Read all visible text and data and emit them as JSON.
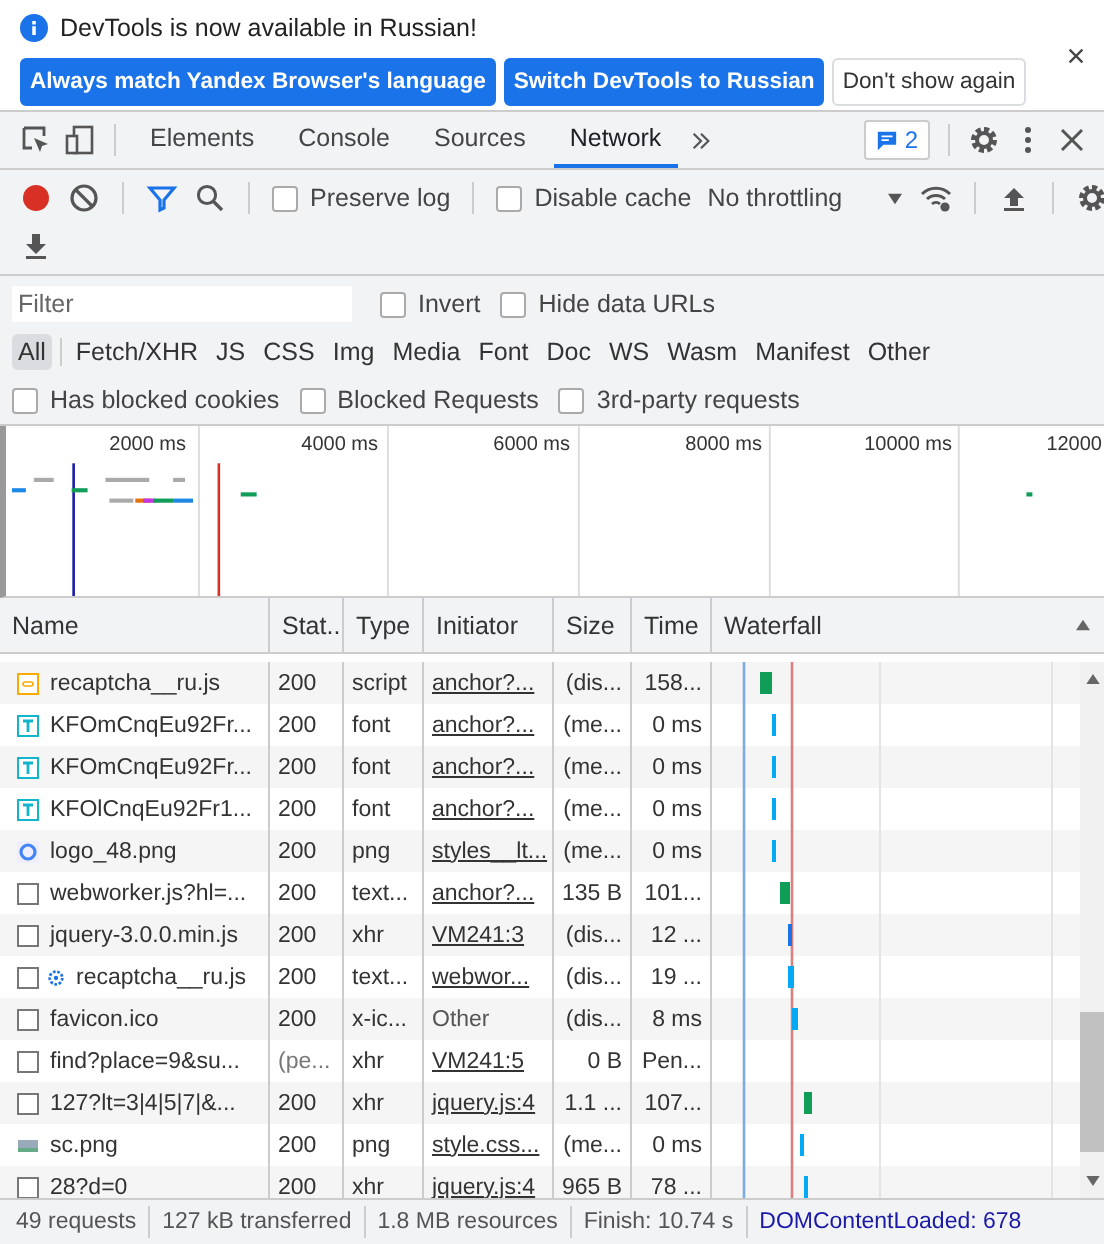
{
  "infobar": {
    "message": "DevTools is now available in Russian!",
    "buttons": [
      {
        "label": "Always match Yandex Browser's language",
        "kind": "primary"
      },
      {
        "label": "Switch DevTools to Russian",
        "kind": "primary"
      },
      {
        "label": "Don't show again",
        "kind": "secondary"
      }
    ]
  },
  "tabs": [
    {
      "label": "Elements",
      "selected": false
    },
    {
      "label": "Console",
      "selected": false
    },
    {
      "label": "Sources",
      "selected": false
    },
    {
      "label": "Network",
      "selected": true
    }
  ],
  "issues_badge": "2",
  "toolbar": {
    "recording": true,
    "filter_active": true,
    "checkboxes": [
      {
        "label": "Preserve log",
        "checked": false
      },
      {
        "label": "Disable cache",
        "checked": false
      }
    ],
    "throttling": "No throttling"
  },
  "filter": {
    "placeholder": "Filter",
    "checkboxes": [
      {
        "label": "Invert",
        "checked": false
      },
      {
        "label": "Hide data URLs",
        "checked": false
      }
    ]
  },
  "type_filters": [
    {
      "label": "All",
      "selected": true
    },
    {
      "label": "Fetch/XHR",
      "selected": false
    },
    {
      "label": "JS",
      "selected": false
    },
    {
      "label": "CSS",
      "selected": false
    },
    {
      "label": "Img",
      "selected": false
    },
    {
      "label": "Media",
      "selected": false
    },
    {
      "label": "Font",
      "selected": false
    },
    {
      "label": "Doc",
      "selected": false
    },
    {
      "label": "WS",
      "selected": false
    },
    {
      "label": "Wasm",
      "selected": false
    },
    {
      "label": "Manifest",
      "selected": false
    },
    {
      "label": "Other",
      "selected": false
    }
  ],
  "blocked_filters": [
    {
      "label": "Has blocked cookies",
      "checked": false
    },
    {
      "label": "Blocked Requests",
      "checked": false
    },
    {
      "label": "3rd-party requests",
      "checked": false
    }
  ],
  "overview": {
    "ticks": [
      "2000 ms",
      "4000 ms",
      "6000 ms",
      "8000 ms",
      "10000 ms",
      "12000"
    ]
  },
  "table": {
    "columns": [
      "Name",
      "Stat...",
      "Type",
      "Initiator",
      "Size",
      "Time",
      "Waterfall"
    ],
    "rows": [
      {
        "kind": "script",
        "name": "recaptcha__ru.js",
        "status": "200",
        "type": "script",
        "initiator": "anchor?...",
        "initiator_link": true,
        "size": "(dis...",
        "time": "158..."
      },
      {
        "kind": "font",
        "name": "KFOmCnqEu92Fr...",
        "status": "200",
        "type": "font",
        "initiator": "anchor?...",
        "initiator_link": true,
        "size": "(me...",
        "time": "0 ms"
      },
      {
        "kind": "font",
        "name": "KFOmCnqEu92Fr...",
        "status": "200",
        "type": "font",
        "initiator": "anchor?...",
        "initiator_link": true,
        "size": "(me...",
        "time": "0 ms"
      },
      {
        "kind": "font",
        "name": "KFOlCnqEu92Fr1...",
        "status": "200",
        "type": "font",
        "initiator": "anchor?...",
        "initiator_link": true,
        "size": "(me...",
        "time": "0 ms"
      },
      {
        "kind": "logo",
        "name": "logo_48.png",
        "status": "200",
        "type": "png",
        "initiator": "styles__lt...",
        "initiator_link": true,
        "size": "(me...",
        "time": "0 ms"
      },
      {
        "kind": "doc",
        "name": "webworker.js?hl=...",
        "status": "200",
        "type": "text...",
        "initiator": "anchor?...",
        "initiator_link": true,
        "size": "135 B",
        "time": "101..."
      },
      {
        "kind": "doc",
        "name": "jquery-3.0.0.min.js",
        "status": "200",
        "type": "xhr",
        "initiator": "VM241:3",
        "initiator_link": true,
        "size": "(dis...",
        "time": "12 ..."
      },
      {
        "kind": "worker",
        "name": "recaptcha__ru.js",
        "status": "200",
        "type": "text...",
        "initiator": "webwor...",
        "initiator_link": true,
        "size": "(dis...",
        "time": "19 ..."
      },
      {
        "kind": "doc",
        "name": "favicon.ico",
        "status": "200",
        "type": "x-ic...",
        "initiator": "Other",
        "initiator_link": false,
        "size": "(dis...",
        "time": "8 ms"
      },
      {
        "kind": "doc",
        "name": "find?place=9&su...",
        "status": "(pe...",
        "type": "xhr",
        "initiator": "VM241:5",
        "initiator_link": true,
        "size": "0 B",
        "time": "Pen..."
      },
      {
        "kind": "doc",
        "name": "127?lt=3|4|5|7|&...",
        "status": "200",
        "type": "xhr",
        "initiator": "jquery.js:4",
        "initiator_link": true,
        "size": "1.1 ...",
        "time": "107..."
      },
      {
        "kind": "image",
        "name": "sc.png",
        "status": "200",
        "type": "png",
        "initiator": "style.css...",
        "initiator_link": true,
        "size": "(me...",
        "time": "0 ms"
      },
      {
        "kind": "doc",
        "name": "28?d=0",
        "status": "200",
        "type": "xhr",
        "initiator": "jquery.js:4",
        "initiator_link": true,
        "size": "965 B",
        "time": "78 ..."
      }
    ]
  },
  "status_bar": [
    {
      "text": "49 requests",
      "kind": "plain"
    },
    {
      "text": "127 kB transferred",
      "kind": "plain"
    },
    {
      "text": "1.8 MB resources",
      "kind": "plain"
    },
    {
      "text": "Finish: 10.74 s",
      "kind": "plain"
    },
    {
      "text": "DOMContentLoaded: 678",
      "kind": "dcl"
    }
  ]
}
